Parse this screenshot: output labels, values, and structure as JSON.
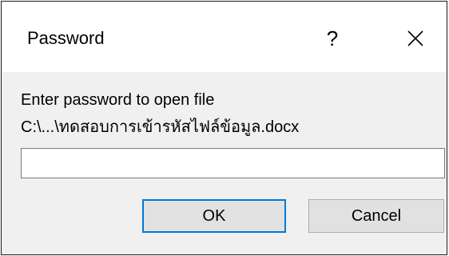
{
  "dialog": {
    "title": "Password",
    "help_glyph": "?",
    "close_icon": "close-icon",
    "prompt": "Enter password to open file",
    "file_path": "C:\\...\\ทดสอบการเข้ารหัสไฟล์ข้อมูล.docx",
    "password_value": "",
    "ok_label": "OK",
    "cancel_label": "Cancel",
    "accent_color": "#0078d7"
  }
}
